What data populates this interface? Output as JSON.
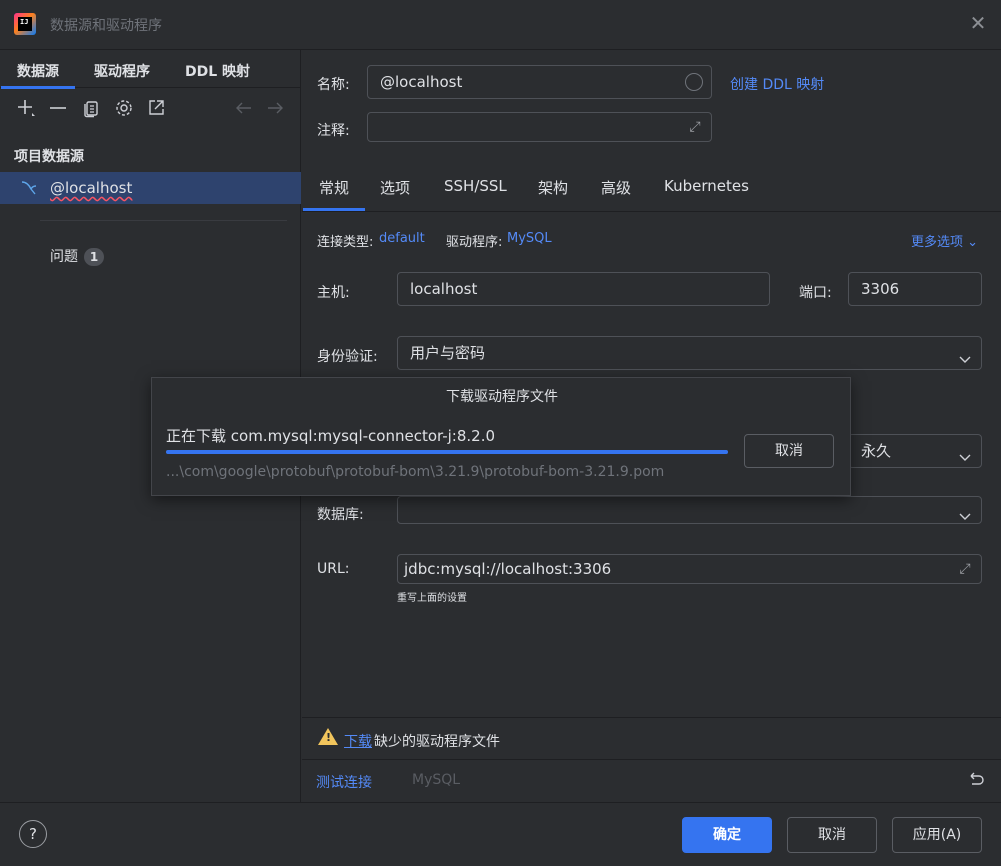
{
  "window": {
    "title": "数据源和驱动程序"
  },
  "left": {
    "tabs": [
      {
        "label": "数据源",
        "active": true
      },
      {
        "label": "驱动程序",
        "active": false
      },
      {
        "label": "DDL 映射",
        "active": false
      }
    ],
    "toolbar": [
      "add-icon",
      "remove-icon",
      "copy-icon",
      "settings-icon",
      "export-icon",
      "back-arrow-icon",
      "forward-arrow-icon"
    ],
    "section_title": "项目数据源",
    "datasource": "@localhost",
    "problems_label": "问题",
    "problems_count": "1"
  },
  "form": {
    "name_label": "名称:",
    "name_value": "@localhost",
    "create_ddl_link": "创建 DDL 映射",
    "comment_label": "注释:",
    "comment_value": "",
    "tabs": [
      "常规",
      "选项",
      "SSH/SSL",
      "架构",
      "高级",
      "Kubernetes"
    ],
    "active_tab": "常规",
    "conn_type_label": "连接类型:",
    "conn_type_value": "default",
    "driver_label": "驱动程序:",
    "driver_value": "MySQL",
    "more_options": "更多选项",
    "host_label": "主机:",
    "host_value": "localhost",
    "port_label": "端口:",
    "port_value": "3306",
    "auth_label": "身份验证:",
    "auth_value": "用户与密码",
    "save_value": "永久",
    "database_label": "数据库:",
    "database_value": "",
    "url_label": "URL:",
    "url_value": "jdbc:mysql://localhost:3306",
    "url_hint": "重写上面的设置"
  },
  "footer": {
    "download_link": "下载",
    "missing_text": "缺少的驱动程序文件",
    "test_connection": "测试连接",
    "driver_name": "MySQL"
  },
  "download_dialog": {
    "title": "下载驱动程序文件",
    "status": "正在下载 com.mysql:mysql-connector-j:8.2.0",
    "progress": 1.0,
    "path": "...\\com\\google\\protobuf\\protobuf-bom\\3.21.9\\protobuf-bom-3.21.9.pom",
    "cancel": "取消"
  },
  "buttons": {
    "help": "?",
    "ok": "确定",
    "cancel": "取消",
    "apply": "应用(A)"
  },
  "colors": {
    "accent": "#3574f0",
    "link": "#548af7",
    "warning": "#f2c55c",
    "selection": "#2e436e"
  }
}
